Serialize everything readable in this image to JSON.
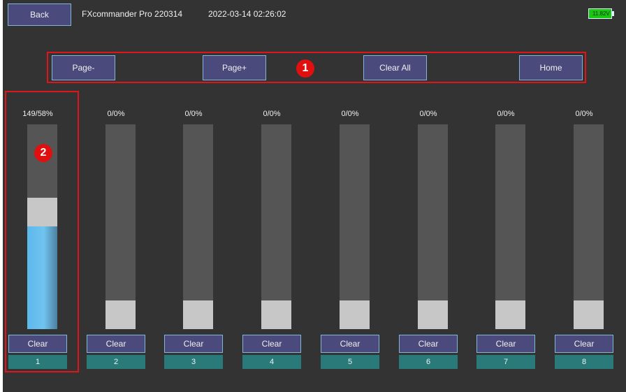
{
  "header": {
    "back_label": "Back",
    "app_title": "FXcommander Pro 220314",
    "datetime": "2022-03-14 02:26:02",
    "battery_voltage": "11.82V"
  },
  "nav": {
    "page_minus_label": "Page-",
    "page_plus_label": "Page+",
    "clear_all_label": "Clear All",
    "home_label": "Home"
  },
  "annotations": {
    "marker_1": "1",
    "marker_2": "2"
  },
  "channels": [
    {
      "number": "1",
      "value_text": "149/58%",
      "clear_label": "Clear",
      "fill_fraction": 0.5,
      "grey_fraction": 0.14
    },
    {
      "number": "2",
      "value_text": "0/0%",
      "clear_label": "Clear",
      "fill_fraction": 0,
      "grey_fraction": 0.14
    },
    {
      "number": "3",
      "value_text": "0/0%",
      "clear_label": "Clear",
      "fill_fraction": 0,
      "grey_fraction": 0.14
    },
    {
      "number": "4",
      "value_text": "0/0%",
      "clear_label": "Clear",
      "fill_fraction": 0,
      "grey_fraction": 0.14
    },
    {
      "number": "5",
      "value_text": "0/0%",
      "clear_label": "Clear",
      "fill_fraction": 0,
      "grey_fraction": 0.14
    },
    {
      "number": "6",
      "value_text": "0/0%",
      "clear_label": "Clear",
      "fill_fraction": 0,
      "grey_fraction": 0.14
    },
    {
      "number": "7",
      "value_text": "0/0%",
      "clear_label": "Clear",
      "fill_fraction": 0,
      "grey_fraction": 0.14
    },
    {
      "number": "8",
      "value_text": "0/0%",
      "clear_label": "Clear",
      "fill_fraction": 0,
      "grey_fraction": 0.14
    }
  ],
  "colors": {
    "screen_bg": "#333333",
    "button_bg": "#4b4a7d",
    "button_border": "#7fb7d9",
    "channel_label_bg": "#2a7a7a",
    "bar_bg": "#555555",
    "bar_fill": "#5db8ed",
    "annotation_red": "#e0141b",
    "battery_green": "#18c70f"
  }
}
